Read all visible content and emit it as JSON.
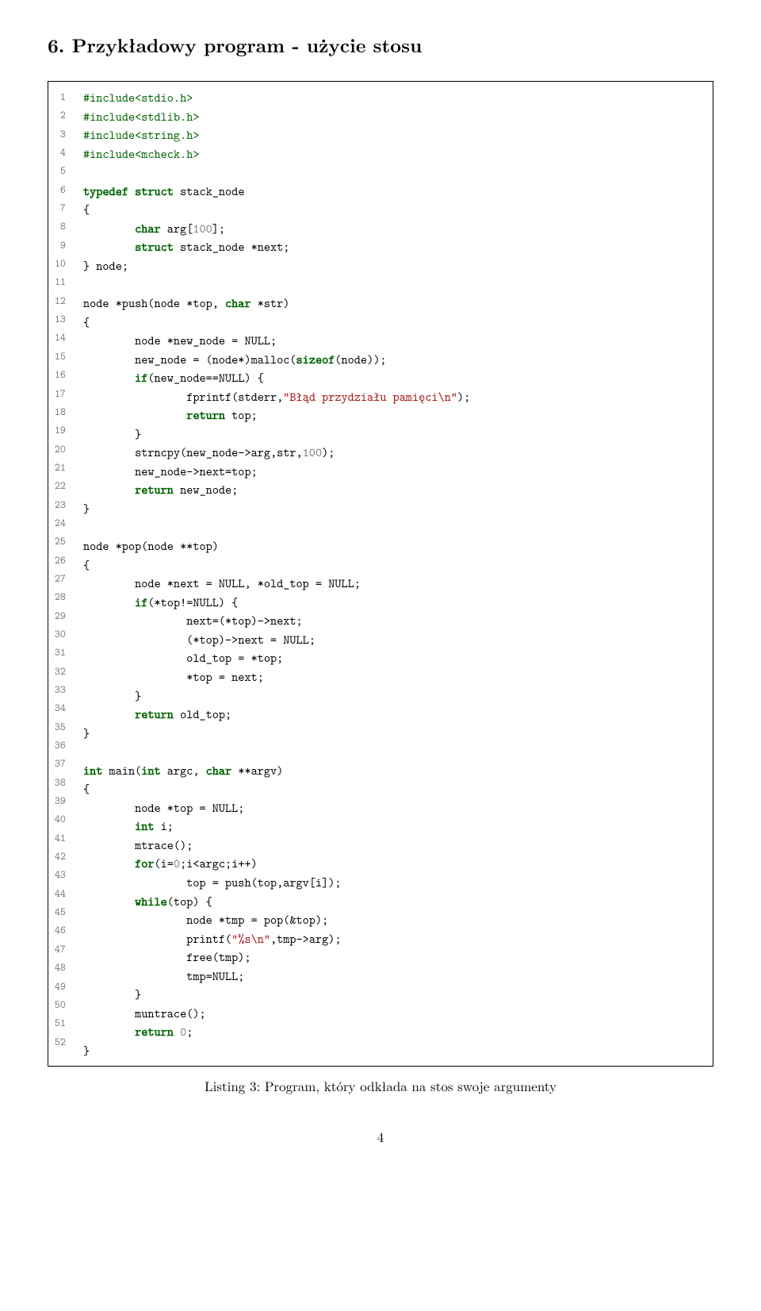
{
  "heading": "6.   Przykładowy program - użycie stosu",
  "caption": "Listing 3: Program, który odkłada na stos swoje argumenty",
  "pageno": "4",
  "code": {
    "lines": [
      [
        {
          "t": "#include<stdio.h>",
          "c": "pp"
        }
      ],
      [
        {
          "t": "#include<stdlib.h>",
          "c": "pp"
        }
      ],
      [
        {
          "t": "#include<string.h>",
          "c": "pp"
        }
      ],
      [
        {
          "t": "#include<mcheck.h>",
          "c": "pp"
        }
      ],
      [],
      [
        {
          "t": "typedef struct",
          "c": "kw"
        },
        {
          "t": " stack_node"
        }
      ],
      [
        {
          "t": "{"
        }
      ],
      [
        {
          "t": "        "
        },
        {
          "t": "char",
          "c": "kw"
        },
        {
          "t": " arg["
        },
        {
          "t": "100",
          "c": "num"
        },
        {
          "t": "];"
        }
      ],
      [
        {
          "t": "        "
        },
        {
          "t": "struct",
          "c": "kw"
        },
        {
          "t": " stack_node *next;"
        }
      ],
      [
        {
          "t": "} node;"
        }
      ],
      [],
      [
        {
          "t": "node *push(node *top, "
        },
        {
          "t": "char",
          "c": "kw"
        },
        {
          "t": " *str)"
        }
      ],
      [
        {
          "t": "{"
        }
      ],
      [
        {
          "t": "        node *new_node = NULL;"
        }
      ],
      [
        {
          "t": "        new_node = (node*)malloc("
        },
        {
          "t": "sizeof",
          "c": "kw"
        },
        {
          "t": "(node));"
        }
      ],
      [
        {
          "t": "        "
        },
        {
          "t": "if",
          "c": "kw"
        },
        {
          "t": "(new_node==NULL) {"
        }
      ],
      [
        {
          "t": "                fprintf(stderr,"
        },
        {
          "t": "\"Błąd przydziału pamięci\\n\"",
          "c": "str"
        },
        {
          "t": ");"
        }
      ],
      [
        {
          "t": "                "
        },
        {
          "t": "return",
          "c": "kw"
        },
        {
          "t": " top;"
        }
      ],
      [
        {
          "t": "        }"
        }
      ],
      [
        {
          "t": "        strncpy(new_node->arg,str,"
        },
        {
          "t": "100",
          "c": "num"
        },
        {
          "t": ");"
        }
      ],
      [
        {
          "t": "        new_node->next=top;"
        }
      ],
      [
        {
          "t": "        "
        },
        {
          "t": "return",
          "c": "kw"
        },
        {
          "t": " new_node;"
        }
      ],
      [
        {
          "t": "}"
        }
      ],
      [],
      [
        {
          "t": "node *pop(node **top)"
        }
      ],
      [
        {
          "t": "{"
        }
      ],
      [
        {
          "t": "        node *next = NULL, *old_top = NULL;"
        }
      ],
      [
        {
          "t": "        "
        },
        {
          "t": "if",
          "c": "kw"
        },
        {
          "t": "(*top!=NULL) {"
        }
      ],
      [
        {
          "t": "                next=(*top)->next;"
        }
      ],
      [
        {
          "t": "                (*top)->next = NULL;"
        }
      ],
      [
        {
          "t": "                old_top = *top;"
        }
      ],
      [
        {
          "t": "                *top = next;"
        }
      ],
      [
        {
          "t": "        }"
        }
      ],
      [
        {
          "t": "        "
        },
        {
          "t": "return",
          "c": "kw"
        },
        {
          "t": " old_top;"
        }
      ],
      [
        {
          "t": "}"
        }
      ],
      [],
      [
        {
          "t": "int",
          "c": "kw"
        },
        {
          "t": " main("
        },
        {
          "t": "int",
          "c": "kw"
        },
        {
          "t": " argc, "
        },
        {
          "t": "char",
          "c": "kw"
        },
        {
          "t": " **argv)"
        }
      ],
      [
        {
          "t": "{"
        }
      ],
      [
        {
          "t": "        node *top = NULL;"
        }
      ],
      [
        {
          "t": "        "
        },
        {
          "t": "int",
          "c": "kw"
        },
        {
          "t": " i;"
        }
      ],
      [
        {
          "t": "        mtrace();"
        }
      ],
      [
        {
          "t": "        "
        },
        {
          "t": "for",
          "c": "kw"
        },
        {
          "t": "(i="
        },
        {
          "t": "0",
          "c": "num"
        },
        {
          "t": ";i<argc;i++)"
        }
      ],
      [
        {
          "t": "                top = push(top,argv[i]);"
        }
      ],
      [
        {
          "t": "        "
        },
        {
          "t": "while",
          "c": "kw"
        },
        {
          "t": "(top) {"
        }
      ],
      [
        {
          "t": "                node *tmp = pop(&top);"
        }
      ],
      [
        {
          "t": "                printf("
        },
        {
          "t": "\"%s\\n\"",
          "c": "str"
        },
        {
          "t": ",tmp->arg);"
        }
      ],
      [
        {
          "t": "                free(tmp);"
        }
      ],
      [
        {
          "t": "                tmp=NULL;"
        }
      ],
      [
        {
          "t": "        }"
        }
      ],
      [
        {
          "t": "        muntrace();"
        }
      ],
      [
        {
          "t": "        "
        },
        {
          "t": "return",
          "c": "kw"
        },
        {
          "t": " "
        },
        {
          "t": "0",
          "c": "num"
        },
        {
          "t": ";"
        }
      ],
      [
        {
          "t": "}"
        }
      ]
    ]
  }
}
